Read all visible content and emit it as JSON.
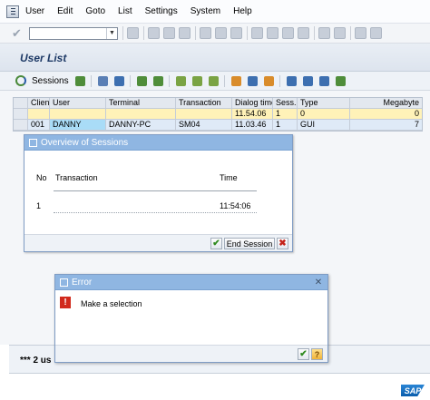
{
  "menu": {
    "items": [
      "User",
      "Edit",
      "Goto",
      "List",
      "Settings",
      "System",
      "Help"
    ]
  },
  "toolbar": {
    "command_value": ""
  },
  "title": "User List",
  "app_toolbar": {
    "sessions_label": "Sessions"
  },
  "grid": {
    "headers": [
      "Client",
      "User",
      "Terminal",
      "Transaction",
      "Dialog time",
      "Sess.",
      "Type",
      "Megabyte"
    ],
    "rows": [
      [
        "",
        "",
        "",
        "",
        "11.54.06",
        "1",
        "0",
        "0"
      ],
      [
        "001",
        "DANNY",
        "DANNY-PC",
        "SM04",
        "11.03.46",
        "1",
        "GUI",
        "7"
      ]
    ]
  },
  "sessions_popup": {
    "title": "Overview of Sessions",
    "col_no": "No",
    "col_transaction": "Transaction",
    "col_time": "Time",
    "row_no": "1",
    "row_transaction": "",
    "row_time": "11:54:06",
    "end_session_label": "End Session"
  },
  "status": {
    "text": "*** 2 us"
  },
  "error_dialog": {
    "title": "Error",
    "message": "Make a selection"
  },
  "logo_text": "SAP"
}
